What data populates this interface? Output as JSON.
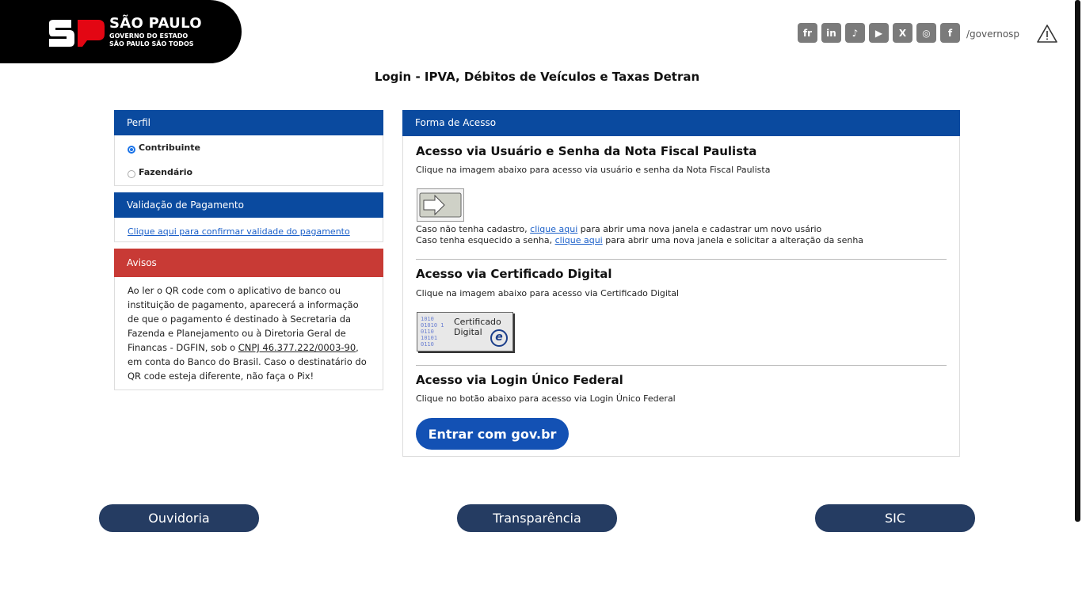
{
  "header": {
    "logo_title": "SÃO PAULO",
    "logo_sub1": "GOVERNO DO ESTADO",
    "logo_sub2": "SÃO PAULO SÃO TODOS",
    "social_icons": [
      "flickr-icon",
      "linkedin-icon",
      "tiktok-icon",
      "youtube-icon",
      "x-icon",
      "instagram-icon",
      "facebook-icon"
    ],
    "social_glyphs": [
      "fr",
      "in",
      "♪",
      "▶",
      "X",
      "◎",
      "f"
    ],
    "social_handle": "/governosp"
  },
  "page_title": "Login - IPVA, Débitos de Veículos e Taxas Detran",
  "perfil": {
    "header": "Perfil",
    "options": [
      {
        "label": "Contribuinte",
        "checked": true
      },
      {
        "label": "Fazendário",
        "checked": false
      }
    ]
  },
  "validacao": {
    "header": "Validação de Pagamento",
    "link": "Clique aqui para confirmar validade do pagamento"
  },
  "avisos": {
    "header": "Avisos",
    "text_before": "Ao ler o QR code com o aplicativo de banco ou instituição de pagamento, aparecerá a informação de que o pagamento é destinado à Secretaria da Fazenda e Planejamento ou à Diretoria Geral de Financas - DGFIN, sob o ",
    "cnpj": "CNPJ 46.377.222/0003-90",
    "text_after": ", em conta do Banco do Brasil. Caso o destinatário do QR code esteja diferente, não faça o Pix!"
  },
  "forma": {
    "header": "Forma de Acesso",
    "nfp": {
      "title": "Acesso via Usuário e Senha da Nota Fiscal Paulista",
      "desc": "Clique na imagem abaixo para acesso via usuário e senha da Nota Fiscal Paulista",
      "line1_before": "Caso não tenha cadastro, ",
      "line1_link": "clique aqui",
      "line1_after": " para abrir uma nova janela e cadastrar um novo usário",
      "line2_before": "Caso tenha esquecido a senha, ",
      "line2_link": "clique aqui",
      "line2_after": " para abrir uma nova janela e solicitar a alteração da senha"
    },
    "cert": {
      "title": "Acesso via Certificado Digital",
      "desc": "Clique na imagem abaixo para acesso via Certificado Digital",
      "img_line1": "Certificado",
      "img_line2": "Digital"
    },
    "gov": {
      "title": "Acesso via Login Único Federal",
      "desc": "Clique no botão abaixo para acesso via Login Único Federal",
      "button": "Entrar com gov.br"
    }
  },
  "footer": {
    "ouvidoria": "Ouvidoria",
    "transparencia": "Transparência",
    "sic": "SIC"
  },
  "colors": {
    "header_blue": "#0a4a9f",
    "avisos_red": "#c83a35",
    "govbr_blue": "#1351b4",
    "footer_navy": "#253c62"
  }
}
